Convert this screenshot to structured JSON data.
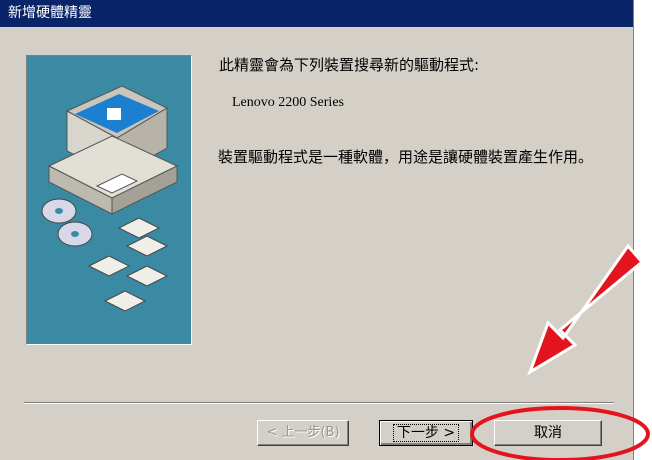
{
  "window": {
    "title": "新增硬體精靈"
  },
  "content": {
    "intro": "此精靈會為下列裝置搜尋新的驅動程式:",
    "device_name": "Lenovo 2200 Series",
    "description": "裝置驅動程式是一種軟體，用途是讓硬體裝置產生作用。"
  },
  "buttons": {
    "back_label": "< 上一步(B)",
    "next_label": "下一步 >",
    "cancel_label": "取消"
  },
  "annotation": {
    "color": "#e4141e"
  }
}
